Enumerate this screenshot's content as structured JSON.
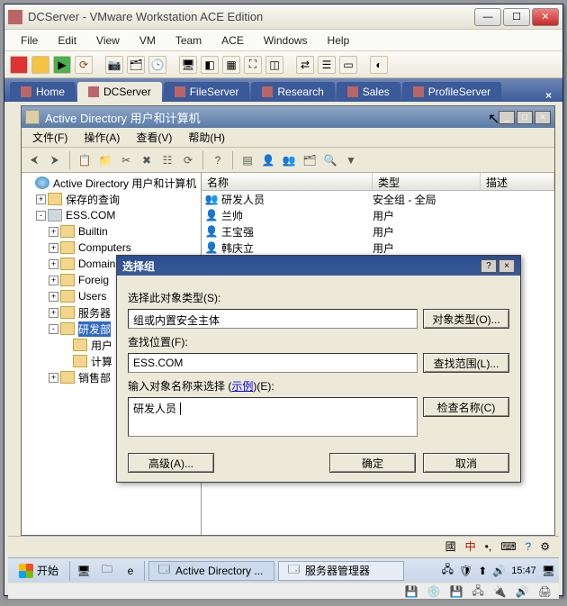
{
  "vmware": {
    "title": "DCServer - VMware Workstation ACE Edition",
    "menus": [
      "File",
      "Edit",
      "View",
      "VM",
      "Team",
      "ACE",
      "Windows",
      "Help"
    ],
    "tabs": [
      {
        "icon": "home",
        "label": "Home"
      },
      {
        "icon": "vm",
        "label": "DCServer",
        "active": true
      },
      {
        "icon": "vm",
        "label": "FileServer"
      },
      {
        "icon": "vm",
        "label": "Research"
      },
      {
        "icon": "vm",
        "label": "Sales"
      },
      {
        "icon": "vm",
        "label": "ProfileServer"
      }
    ]
  },
  "mmc": {
    "title": "Active Directory 用户和计算机",
    "menus": [
      "文件(F)",
      "操作(A)",
      "查看(V)",
      "帮助(H)"
    ],
    "tree": [
      {
        "lvl": 0,
        "toggle": "",
        "icon": "globe",
        "label": "Active Directory 用户和计算机"
      },
      {
        "lvl": 1,
        "toggle": "+",
        "icon": "folder",
        "label": "保存的查询"
      },
      {
        "lvl": 1,
        "toggle": "-",
        "icon": "domain",
        "label": "ESS.COM"
      },
      {
        "lvl": 2,
        "toggle": "+",
        "icon": "folder",
        "label": "Builtin"
      },
      {
        "lvl": 2,
        "toggle": "+",
        "icon": "folder",
        "label": "Computers"
      },
      {
        "lvl": 2,
        "toggle": "+",
        "icon": "folder",
        "label": "Domain Controllers"
      },
      {
        "lvl": 2,
        "toggle": "+",
        "icon": "folder",
        "label": "Foreig"
      },
      {
        "lvl": 2,
        "toggle": "+",
        "icon": "folder",
        "label": "Users"
      },
      {
        "lvl": 2,
        "toggle": "+",
        "icon": "folder",
        "label": "服务器"
      },
      {
        "lvl": 2,
        "toggle": "-",
        "icon": "folder",
        "label": "研发部",
        "sel": true
      },
      {
        "lvl": 3,
        "toggle": "",
        "icon": "folder",
        "label": "用户"
      },
      {
        "lvl": 3,
        "toggle": "",
        "icon": "folder",
        "label": "计算"
      },
      {
        "lvl": 2,
        "toggle": "+",
        "icon": "folder",
        "label": "销售部"
      }
    ],
    "columns": {
      "name": "名称",
      "type": "类型",
      "desc": "描述"
    },
    "rows": [
      {
        "icon": "👥",
        "name": "研发人员",
        "type": "安全组 - 全局"
      },
      {
        "icon": "👤",
        "name": "兰帅",
        "type": "用户"
      },
      {
        "icon": "👤",
        "name": "王宝强",
        "type": "用户"
      },
      {
        "icon": "👤",
        "name": "韩庆立",
        "type": "用户"
      }
    ]
  },
  "dialog": {
    "title": "选择组",
    "lbl_objtype": "选择此对象类型(S):",
    "val_objtype": "组或内置安全主体",
    "btn_objtype": "对象类型(O)...",
    "lbl_loc": "查找位置(F):",
    "val_loc": "ESS.COM",
    "btn_loc": "查找范围(L)...",
    "lbl_names_pre": "输入对象名称来选择 (",
    "lbl_names_link": "示例",
    "lbl_names_post": ")(E):",
    "val_names": "研发人员",
    "btn_check": "检查名称(C)",
    "btn_adv": "高级(A)...",
    "btn_ok": "确定",
    "btn_cancel": "取消"
  },
  "status": {
    "ime": "中"
  },
  "taskbar": {
    "start": "开始",
    "tasks": [
      {
        "label": "Active Directory ...",
        "active": true
      },
      {
        "label": "服务器管理器"
      }
    ],
    "clock": "15:47"
  }
}
